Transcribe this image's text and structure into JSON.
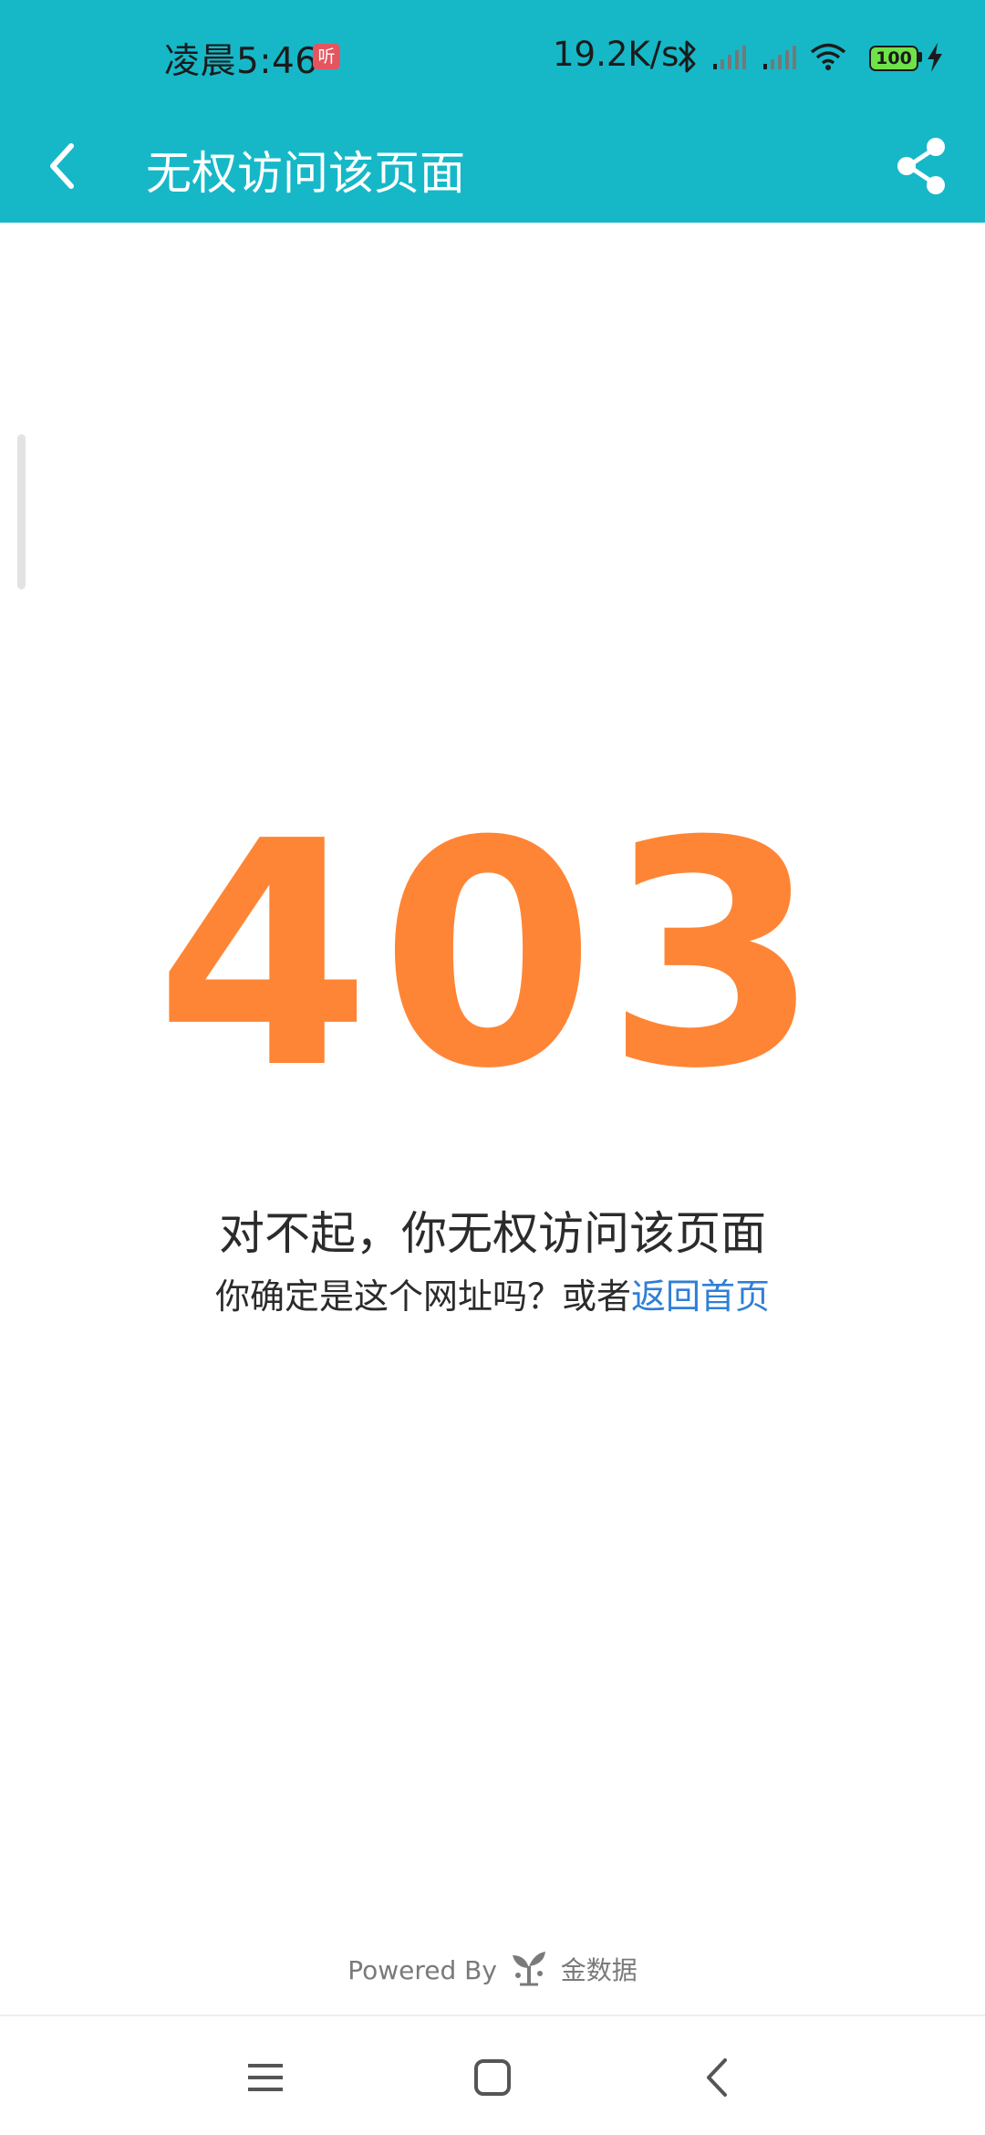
{
  "status_bar": {
    "time": "凌晨5:46",
    "listen_badge": "听",
    "net_speed": "19.2K/s",
    "battery_level": "100",
    "icons": [
      "bluetooth-icon",
      "signal-icon",
      "signal-icon",
      "wifi-icon",
      "battery-icon",
      "charging-icon"
    ]
  },
  "app_bar": {
    "title": "无权访问该页面",
    "back_icon": "chevron-left-icon",
    "share_icon": "share-icon",
    "background": "#16b8c8"
  },
  "content": {
    "error_code": "403",
    "error_code_color": "#fe8535",
    "title": "对不起，你无权访问该页面",
    "subtitle_prefix": "你确定是这个网址吗？或者",
    "home_link": "返回首页",
    "link_color": "#2f7fd6"
  },
  "footer": {
    "powered_by": "Powered By",
    "brand": "金数据",
    "brand_icon": "sprout-logo-icon"
  },
  "nav_bar": {
    "icons": [
      "menu-icon",
      "home-square-icon",
      "back-icon"
    ]
  }
}
